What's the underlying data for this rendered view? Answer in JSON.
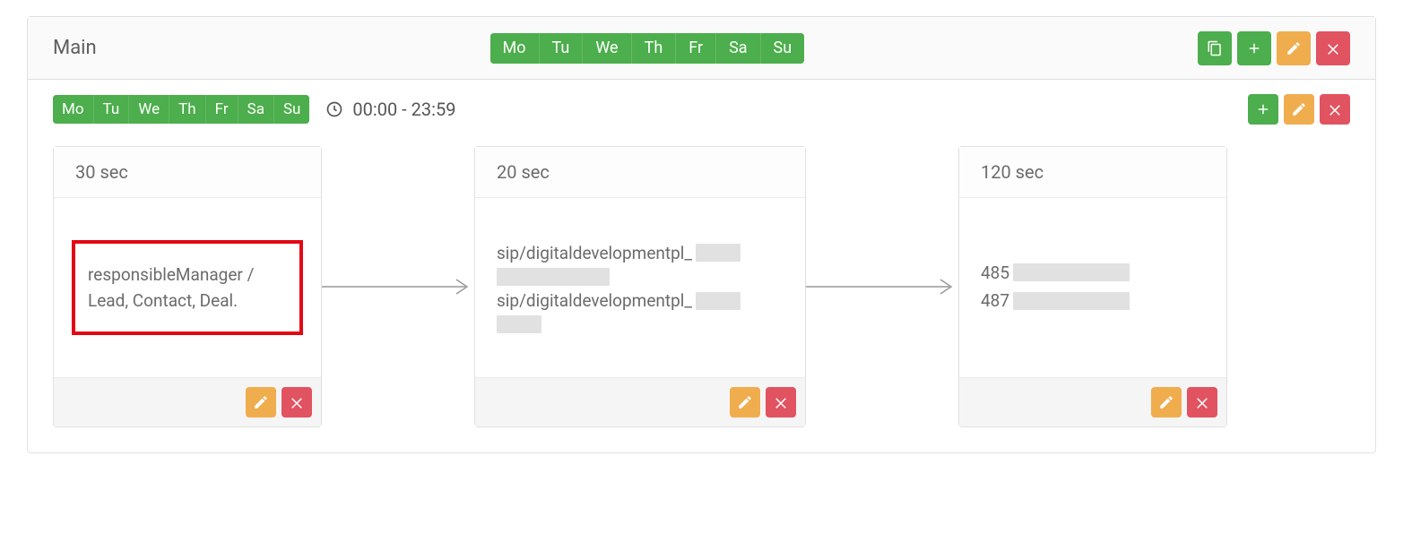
{
  "header": {
    "title": "Main",
    "days": [
      "Mo",
      "Tu",
      "We",
      "Th",
      "Fr",
      "Sa",
      "Su"
    ]
  },
  "schedule": {
    "days": [
      "Mo",
      "Tu",
      "We",
      "Th",
      "Fr",
      "Sa",
      "Su"
    ],
    "time_range": "00:00 - 23:59"
  },
  "cards": [
    {
      "duration_label": "30 sec",
      "body_type": "text",
      "text": "responsibleManager / Lead, Contact, Deal.",
      "highlighted": true
    },
    {
      "duration_label": "20 sec",
      "body_type": "sip",
      "lines": [
        {
          "prefix": "sip/digitaldevelopmentpl_",
          "redact_widths": [
            50,
            126
          ]
        },
        {
          "prefix": "sip/digitaldevelopmentpl_",
          "redact_widths": [
            50,
            50
          ]
        }
      ]
    },
    {
      "duration_label": "120 sec",
      "body_type": "numbers",
      "lines": [
        {
          "prefix": "485",
          "redact_width": 130
        },
        {
          "prefix": "487",
          "redact_width": 130
        }
      ]
    }
  ],
  "icons": {
    "copy": "copy",
    "plus": "plus",
    "pencil": "pencil",
    "close": "close",
    "clock": "clock"
  }
}
